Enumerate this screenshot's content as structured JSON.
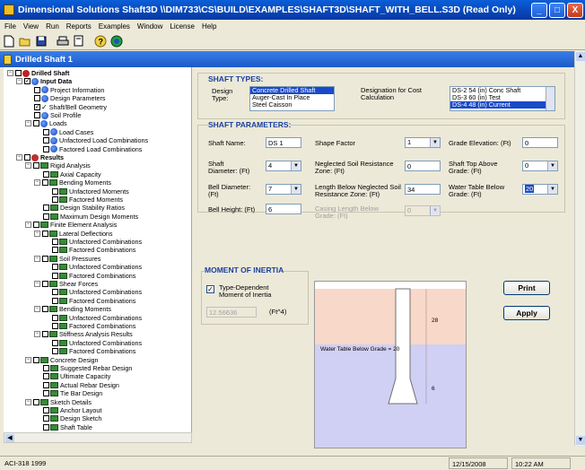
{
  "window": {
    "title": "Dimensional Solutions Shaft3D     \\\\DIM733\\CS\\BUILD\\EXAMPLES\\SHAFT3D\\SHAFT_WITH_BELL.S3D (Read Only)",
    "controls": {
      "minimize": "_",
      "maximize": "□",
      "close": "X"
    }
  },
  "menu": [
    "File",
    "View",
    "Run",
    "Reports",
    "Examples",
    "Window",
    "License",
    "Help"
  ],
  "toolbar": {
    "icons": [
      "new-icon",
      "open-icon",
      "save-icon",
      "print-icon",
      "preview-icon",
      "help-icon",
      "about-icon"
    ]
  },
  "child_window": {
    "title": "Drilled Shaft 1"
  },
  "tree": {
    "items": [
      {
        "label": "Drilled Shaft",
        "bold": true
      },
      {
        "label": "Input Data",
        "bold": true
      },
      {
        "label": "Project Information"
      },
      {
        "label": "Design Parameters"
      },
      {
        "label": "Shaft/Bell Geometry"
      },
      {
        "label": "Soil Profile"
      },
      {
        "label": "Loads"
      },
      {
        "label": "Load Cases"
      },
      {
        "label": "Unfactored Load Combinations"
      },
      {
        "label": "Factored Load Combinations"
      },
      {
        "label": "Results",
        "bold": true
      },
      {
        "label": "Rigid Analysis"
      },
      {
        "label": "Axial Capacity"
      },
      {
        "label": "Bending Moments"
      },
      {
        "label": "Unfactored Moments"
      },
      {
        "label": "Factored Moments"
      },
      {
        "label": "Design Stability Ratios"
      },
      {
        "label": "Maximum Design Moments"
      },
      {
        "label": "Finite Element Analysis"
      },
      {
        "label": "Lateral Deflections"
      },
      {
        "label": "Unfactored Combinations"
      },
      {
        "label": "Factored Combinations"
      },
      {
        "label": "Soil Pressures"
      },
      {
        "label": "Unfactored Combinations"
      },
      {
        "label": "Factored Combinations"
      },
      {
        "label": "Shear Forces"
      },
      {
        "label": "Unfactored Combinations"
      },
      {
        "label": "Factored Combinations"
      },
      {
        "label": "Bending Moments"
      },
      {
        "label": "Unfactored Combinations"
      },
      {
        "label": "Factored Combinations"
      },
      {
        "label": "Stiffness Analysis Results"
      },
      {
        "label": "Unfactored Combinations"
      },
      {
        "label": "Factored Combinations"
      },
      {
        "label": "Concrete Design"
      },
      {
        "label": "Suggested Rebar Design"
      },
      {
        "label": "Ultimate Capacity"
      },
      {
        "label": "Actual Rebar Design"
      },
      {
        "label": "Tie Bar Design"
      },
      {
        "label": "Sketch Details"
      },
      {
        "label": "Anchor Layout"
      },
      {
        "label": "Design Sketch"
      },
      {
        "label": "Shaft Table"
      }
    ]
  },
  "shaft_types": {
    "heading": "SHAFT TYPES:",
    "design_type_label": "Design Type:",
    "design_types": [
      "Concrete Drilled Shaft",
      "Auger-Cast In Place",
      "Steel Caisson"
    ],
    "designation_label": "Designation for Cost Calculation",
    "designations": [
      "DS-2    54 (in)  Conc Shaft",
      "DS-3    60 (in)  Test",
      "DS-4    48 (in)  Current"
    ]
  },
  "shaft_parameters": {
    "heading": "SHAFT PARAMETERS:",
    "shaft_name_label": "Shaft Name:",
    "shaft_name": "DS 1",
    "shape_factor_label": "Shape Factor",
    "shape_factor": "1",
    "grade_elevation_label": "Grade Elevation: (Ft)",
    "grade_elevation": "0",
    "shaft_diameter_label": "Shaft Diameter: (Ft)",
    "shaft_diameter": "4",
    "neglected_soil_label": "Neglected Soil Resistance Zone: (Ft)",
    "neglected_soil": "0",
    "shaft_top_label": "Shaft Top Above Grade: (Ft)",
    "shaft_top": "0",
    "bell_diameter_label": "Bell Diameter: (Ft)",
    "bell_diameter": "7",
    "length_below_label": "Length Below Neglected Soil Resistance Zone: (Ft)",
    "length_below": "34",
    "water_table_label": "Water Table Below Grade: (Ft)",
    "water_table": "20",
    "bell_height_label": "Bell Height: (Ft)",
    "bell_height": "6",
    "casing_length_label": "Casing Length Below Grade: (Ft)",
    "casing_length": "0"
  },
  "moment_of_inertia": {
    "heading": "MOMENT OF INERTIA",
    "type_dependent_label": "Type-Dependent Moment of Inertia",
    "type_dependent_checked": true,
    "value": "12.56636",
    "unit": "(Ft^4)"
  },
  "buttons": {
    "print": "Print",
    "apply": "Apply"
  },
  "sketch": {
    "upper_dim": "28",
    "lower_dim": "6",
    "water_label": "Water Table Below Grade = 20",
    "colors": {
      "dry_soil": "#f8d8c8",
      "wet_soil": "#d0d0f4",
      "shaft": "#ffffff"
    }
  },
  "status": {
    "left": "ACI-318 1999",
    "date": "12/15/2008",
    "time": "10:22 AM"
  }
}
